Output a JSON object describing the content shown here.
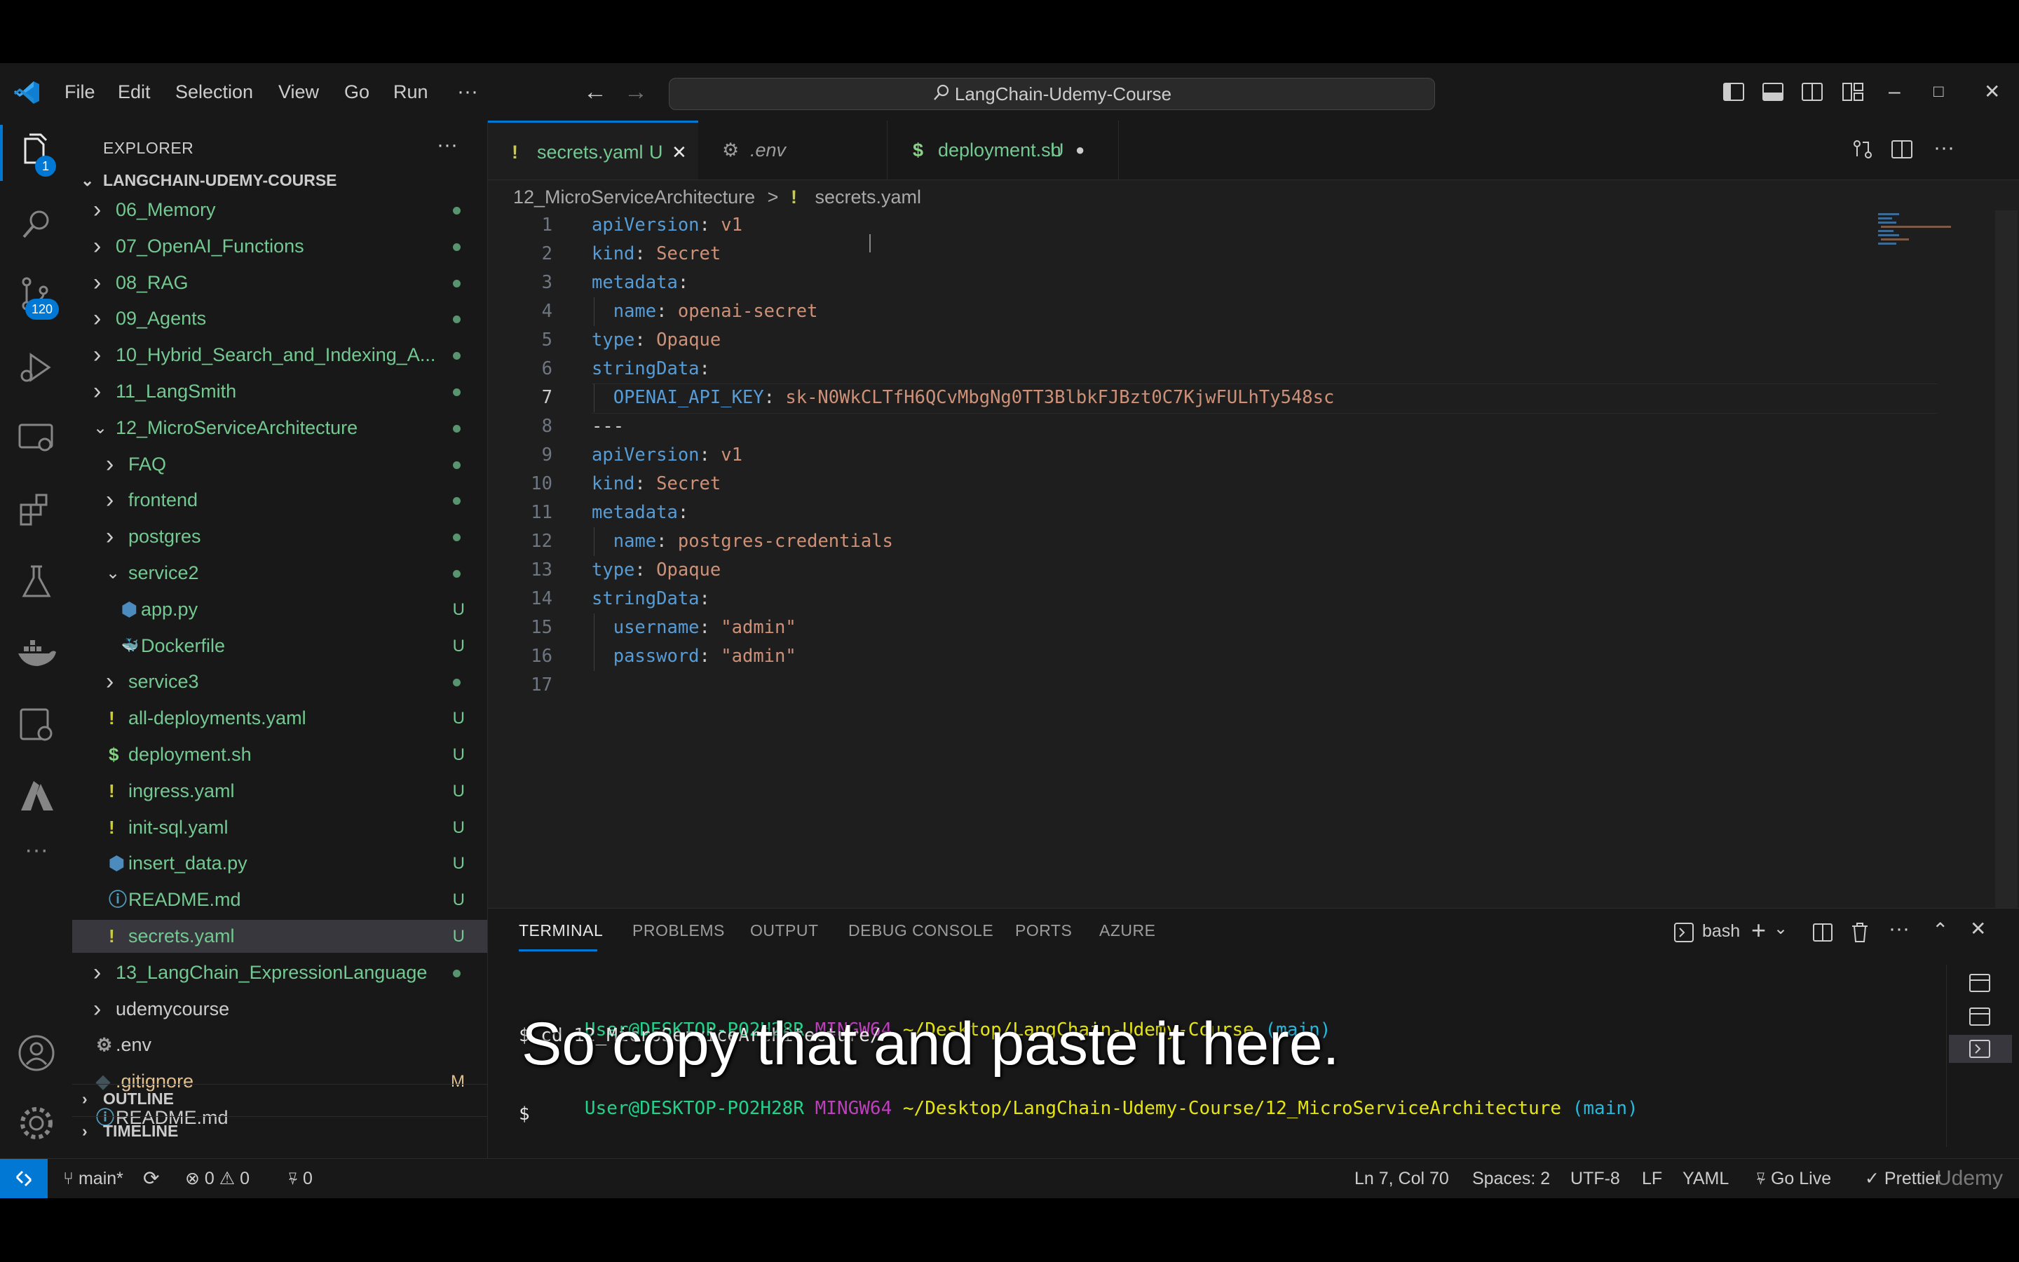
{
  "menu": [
    "File",
    "Edit",
    "Selection",
    "View",
    "Go",
    "Run",
    "···"
  ],
  "search": {
    "text": "LangChain-Udemy-Course"
  },
  "activity": {
    "explorer_badge": "1",
    "scm_badge": "120"
  },
  "explorer": {
    "title": "EXPLORER",
    "root": "LANGCHAIN-UDEMY-COURSE",
    "items": [
      {
        "label": "06_Memory",
        "type": "folder",
        "open": false,
        "depth": 1,
        "status": "dot"
      },
      {
        "label": "07_OpenAI_Functions",
        "type": "folder",
        "open": false,
        "depth": 1,
        "status": "dot"
      },
      {
        "label": "08_RAG",
        "type": "folder",
        "open": false,
        "depth": 1,
        "status": "dot"
      },
      {
        "label": "09_Agents",
        "type": "folder",
        "open": false,
        "depth": 1,
        "status": "dot"
      },
      {
        "label": "10_Hybrid_Search_and_Indexing_A...",
        "type": "folder",
        "open": false,
        "depth": 1,
        "status": "dot"
      },
      {
        "label": "11_LangSmith",
        "type": "folder",
        "open": false,
        "depth": 1,
        "status": "dot"
      },
      {
        "label": "12_MicroServiceArchitecture",
        "type": "folder",
        "open": true,
        "depth": 1,
        "status": "dot"
      },
      {
        "label": "FAQ",
        "type": "folder",
        "open": false,
        "depth": 2,
        "status": "dot"
      },
      {
        "label": "frontend",
        "type": "folder",
        "open": false,
        "depth": 2,
        "status": "dot"
      },
      {
        "label": "postgres",
        "type": "folder",
        "open": false,
        "depth": 2,
        "status": "dot"
      },
      {
        "label": "service2",
        "type": "folder",
        "open": true,
        "depth": 2,
        "status": "dot"
      },
      {
        "label": "app.py",
        "type": "python",
        "depth": 3,
        "status": "U"
      },
      {
        "label": "Dockerfile",
        "type": "docker",
        "depth": 3,
        "status": "U"
      },
      {
        "label": "service3",
        "type": "folder",
        "open": false,
        "depth": 2,
        "status": "dot"
      },
      {
        "label": "all-deployments.yaml",
        "type": "yaml",
        "depth": 2,
        "status": "U"
      },
      {
        "label": "deployment.sh",
        "type": "shell",
        "depth": 2,
        "status": "U"
      },
      {
        "label": "ingress.yaml",
        "type": "yaml",
        "depth": 2,
        "status": "U"
      },
      {
        "label": "init-sql.yaml",
        "type": "yaml",
        "depth": 2,
        "status": "U"
      },
      {
        "label": "insert_data.py",
        "type": "python",
        "depth": 2,
        "status": "U"
      },
      {
        "label": "README.md",
        "type": "info",
        "depth": 2,
        "status": "U"
      },
      {
        "label": "secrets.yaml",
        "type": "yaml",
        "depth": 2,
        "status": "U",
        "selected": true
      },
      {
        "label": "13_LangChain_ExpressionLanguage",
        "type": "folder",
        "open": false,
        "depth": 1,
        "status": "dot"
      },
      {
        "label": "udemycourse",
        "type": "folder-plain",
        "open": false,
        "depth": 1,
        "status": ""
      },
      {
        "label": ".env",
        "type": "gear",
        "depth": 1,
        "status": ""
      },
      {
        "label": ".gitignore",
        "type": "git",
        "depth": 1,
        "status": "M"
      },
      {
        "label": "README.md",
        "type": "info-plain",
        "depth": 1,
        "status": ""
      }
    ],
    "outline": "OUTLINE",
    "timeline": "TIMELINE"
  },
  "tabs": [
    {
      "prefix": "!",
      "label": "secrets.yaml",
      "status": "U",
      "active": true,
      "close": "✕"
    },
    {
      "prefix": "⚙",
      "label": ".env",
      "status": "",
      "active": false,
      "close": ""
    },
    {
      "prefix": "$",
      "label": "deployment.sh",
      "status": "U",
      "active": false,
      "close": "●"
    }
  ],
  "breadcrumb": {
    "folder": "12_MicroServiceArchitecture",
    "sep": ">",
    "icon": "!",
    "file": "secrets.yaml"
  },
  "code": [
    {
      "n": "1",
      "indent": 0,
      "key": "apiVersion",
      "val": "v1"
    },
    {
      "n": "2",
      "indent": 0,
      "key": "kind",
      "val": "Secret"
    },
    {
      "n": "3",
      "indent": 0,
      "key": "metadata",
      "val": ""
    },
    {
      "n": "4",
      "indent": 1,
      "key": "name",
      "val": "openai-secret"
    },
    {
      "n": "5",
      "indent": 0,
      "key": "type",
      "val": "Opaque"
    },
    {
      "n": "6",
      "indent": 0,
      "key": "stringData",
      "val": ""
    },
    {
      "n": "7",
      "indent": 1,
      "key": "OPENAI_API_KEY",
      "val": "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",
      "current": true
    },
    {
      "n": "8",
      "indent": 0,
      "key": "",
      "val": "",
      "raw": "---"
    },
    {
      "n": "9",
      "indent": 0,
      "key": "apiVersion",
      "val": "v1"
    },
    {
      "n": "10",
      "indent": 0,
      "key": "kind",
      "val": "Secret"
    },
    {
      "n": "11",
      "indent": 0,
      "key": "metadata",
      "val": ""
    },
    {
      "n": "12",
      "indent": 1,
      "key": "name",
      "val": "postgres-credentials"
    },
    {
      "n": "13",
      "indent": 0,
      "key": "type",
      "val": "Opaque"
    },
    {
      "n": "14",
      "indent": 0,
      "key": "stringData",
      "val": ""
    },
    {
      "n": "15",
      "indent": 1,
      "key": "username",
      "val": "\"admin\""
    },
    {
      "n": "16",
      "indent": 1,
      "key": "password",
      "val": "\"admin\""
    },
    {
      "n": "17",
      "indent": 0,
      "key": "",
      "val": "",
      "raw": ""
    }
  ],
  "panel": {
    "tabs": [
      "TERMINAL",
      "PROBLEMS",
      "OUTPUT",
      "DEBUG CONSOLE",
      "PORTS",
      "AZURE"
    ],
    "shell": "bash",
    "lines": [
      {
        "user": "User@DESKTOP-PO2H28R",
        "sys": "MINGW64",
        "path": "~/Desktop/LangChain-Udemy-Course",
        "branch": "(main)"
      },
      {
        "prompt": "$ cd 12_MicroServiceArchitecture/"
      },
      {
        "user": "User@DESKTOP-PO2H28R",
        "sys": "MINGW64",
        "path": "~/Desktop/LangChain-Udemy-Course/12_MicroServiceArchitecture",
        "branch": "(main)"
      }
    ]
  },
  "caption": "So copy that and paste it here.",
  "status": {
    "branch": "main*",
    "errors": "0",
    "warnings": "0",
    "ports": "0",
    "position": "Ln 7, Col 70",
    "spaces": "Spaces: 2",
    "encoding": "UTF-8",
    "eol": "LF",
    "language": "YAML",
    "golive": "Go Live",
    "prettier": "Prettier",
    "watermark": "Udemy"
  },
  "colors": {
    "accent": "#0078d4",
    "yaml_key": "#569cd6",
    "yaml_value": "#ce9178",
    "untracked": "#73c991",
    "modified": "#e2c08d"
  }
}
